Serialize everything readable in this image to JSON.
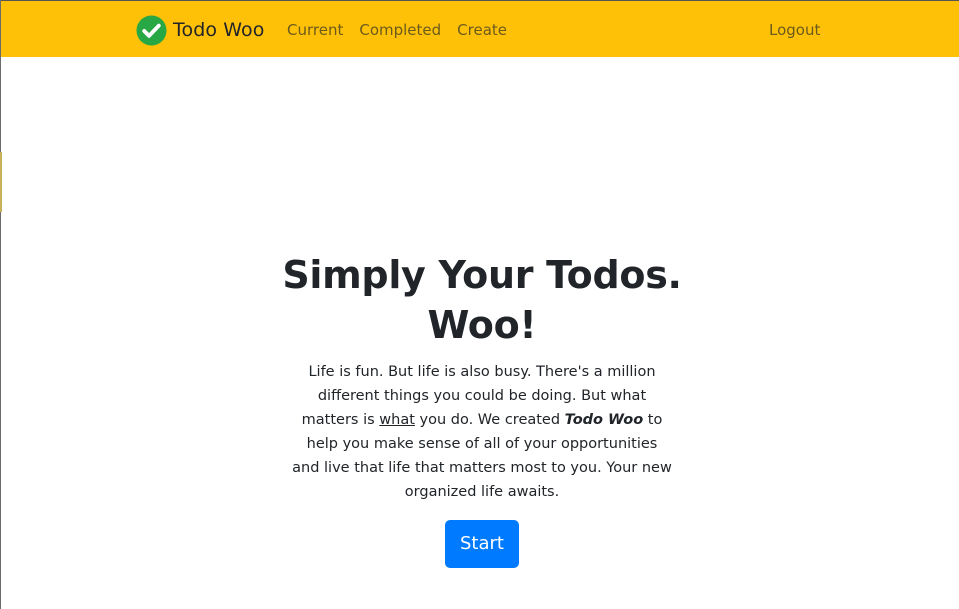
{
  "navbar": {
    "brand_text": "Todo Woo",
    "brand_icon": "check-circle-icon",
    "links": [
      {
        "label": "Current"
      },
      {
        "label": "Completed"
      },
      {
        "label": "Create"
      }
    ],
    "logout_label": "Logout",
    "bg_color": "#ffc107"
  },
  "hero": {
    "title": "Simply Your Todos. Woo!",
    "text_part1": "Life is fun. But life is also busy. There's a million different things you could be doing. But what matters is ",
    "text_underlined": "what",
    "text_part2": " you do. We created ",
    "text_bold": "Todo Woo",
    "text_part3": " to help you make sense of all of your opportunities and live that life that matters most to you. Your new organized life awaits.",
    "button_label": "Start",
    "button_color": "#007bff"
  }
}
